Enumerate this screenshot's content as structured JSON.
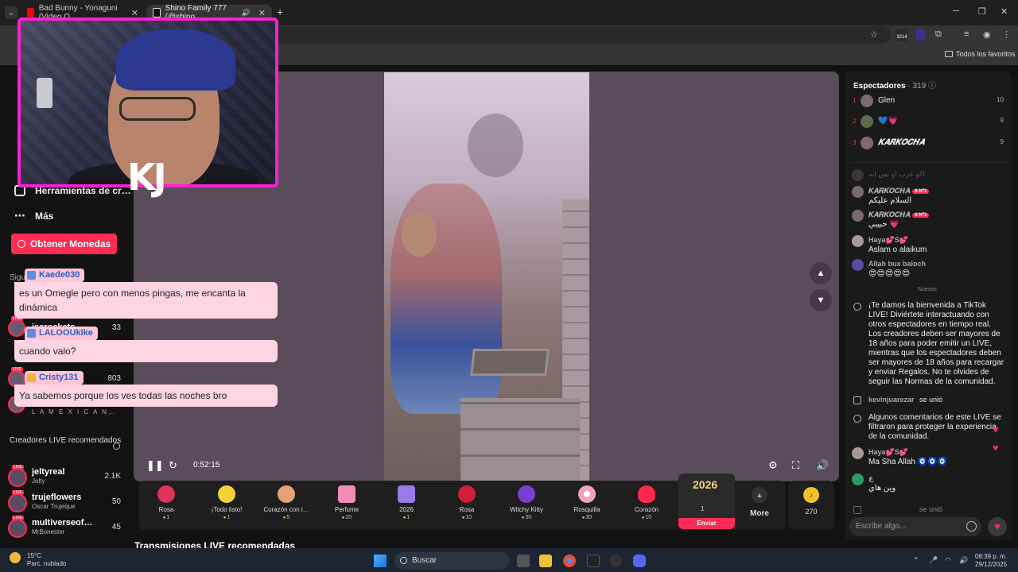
{
  "browser": {
    "tabs": [
      {
        "title": "Bad Bunny - Yonaguni (Video O…"
      },
      {
        "title": "Shino Family 777 (@shino"
      }
    ],
    "bookmarks_label": "Todos los favoritos",
    "extension_badge": "3214"
  },
  "sidebar": {
    "tools_label": "Herramientas de cr…",
    "more_label": "Más",
    "coins_button": "Obtener Monedas",
    "following_label": "Sigu",
    "following": [
      {
        "name": "isarockets",
        "count": "33"
      },
      {
        "name": "",
        "count": "803"
      },
      {
        "name": "",
        "sub": "L A M E X I C A N…"
      }
    ],
    "recommended_header": "Creadores LIVE recomendados",
    "recommended": [
      {
        "name": "jeltyreal",
        "sub": "Jelty",
        "count": "2.1K"
      },
      {
        "name": "trujeflowers",
        "sub": "Oscar Trujeque",
        "count": "50"
      },
      {
        "name": "multiverseof…",
        "sub": "MrBonester",
        "count": "45"
      }
    ]
  },
  "overlay": {
    "streamer_tag": "KJ",
    "chat": [
      {
        "user": "Kaede030",
        "message": "es un Omegle pero con menos pingas, me encanta la dinámica"
      },
      {
        "user": "LALOOUkike",
        "message": "cuando valo?"
      },
      {
        "user": "Cristy131",
        "message": "Ya sabemos porque los ves todas las noches bro"
      }
    ]
  },
  "player": {
    "elapsed": "0:52:15"
  },
  "gifts": [
    {
      "name": "Rosa",
      "price": "1"
    },
    {
      "name": "¡Todo listo!",
      "price": "1"
    },
    {
      "name": "Corazón con l…",
      "price": "5"
    },
    {
      "name": "Perfume",
      "price": "20"
    },
    {
      "name": "2026",
      "price": "1"
    },
    {
      "name": "Rosa",
      "price": "10"
    },
    {
      "name": "Witchy Kitty",
      "price": "30"
    },
    {
      "name": "Rosquilla",
      "price": "30"
    },
    {
      "name": "Corazón",
      "price": "10"
    }
  ],
  "selected_gift": {
    "art": "2026",
    "price": "1",
    "send_label": "Enviar"
  },
  "more_label": "More",
  "coins_balance": "270",
  "recommended_title": "Transmisiones LIVE recomendadas",
  "chat_panel": {
    "viewers_label": "Espectadores",
    "viewers_count": "· 319",
    "top_viewers": [
      {
        "rank": "1",
        "name": "Glen",
        "score": "10"
      },
      {
        "rank": "2",
        "name": "💙💗",
        "score": "9"
      },
      {
        "rank": "3",
        "name": "𝑲𝑨𝑹𝑲𝑶𝑪𝑯𝑨",
        "score": "9"
      }
    ],
    "faded_comment": "اكو عرب او بس انه",
    "comments": [
      {
        "user": "𝑲𝑨𝑹𝑲𝑶𝑪𝑯𝑨",
        "badge": "6 Nº1",
        "text": "السلام عليكم"
      },
      {
        "user": "𝑲𝑨𝑹𝑲𝑶𝑪𝑯𝑨",
        "badge": "6 Nº1",
        "text": "حبيبي 💗"
      },
      {
        "user": "Haya💕S💕",
        "text": "Aslam o alaikum"
      },
      {
        "user": "Allah bux baloch",
        "text": "😍😍😍😍😍"
      }
    ],
    "new_label": "Nuevos",
    "welcome": "¡Te damos la bienvenida a TikTok LIVE! Diviértete interactuando con otros espectadores en tiempo real. Los creadores deben ser mayores de 18 años para poder emitir un LIVE, mientras que los espectadores deben ser mayores de 18 años para recargar y enviar Regalos. No te olvides de seguir las Normas de la comunidad.",
    "join1": {
      "user": "kevinjuarezar",
      "text": "se unió"
    },
    "filtered": "Algunos comentarios de este LIVE se filtraron para proteger la experiencia de la comunidad.",
    "comment5": {
      "user": "Haya💕S💕",
      "text": "Ma Sha Allah 🧿🧿🧿"
    },
    "comment6": {
      "user": "ع",
      "text": "وين هاي"
    },
    "join2": {
      "user": "",
      "text": "se unió"
    },
    "input_placeholder": "Escribe algo..."
  },
  "taskbar": {
    "temp": "15°C",
    "weather": "Parc. nublado",
    "search": "Buscar",
    "time": "08:39 p. m.",
    "date": "29/12/2025"
  },
  "colors": {
    "accent": "#fe2c55",
    "webcam_border": "#ff1fd2",
    "coin": "#f5c02c"
  }
}
